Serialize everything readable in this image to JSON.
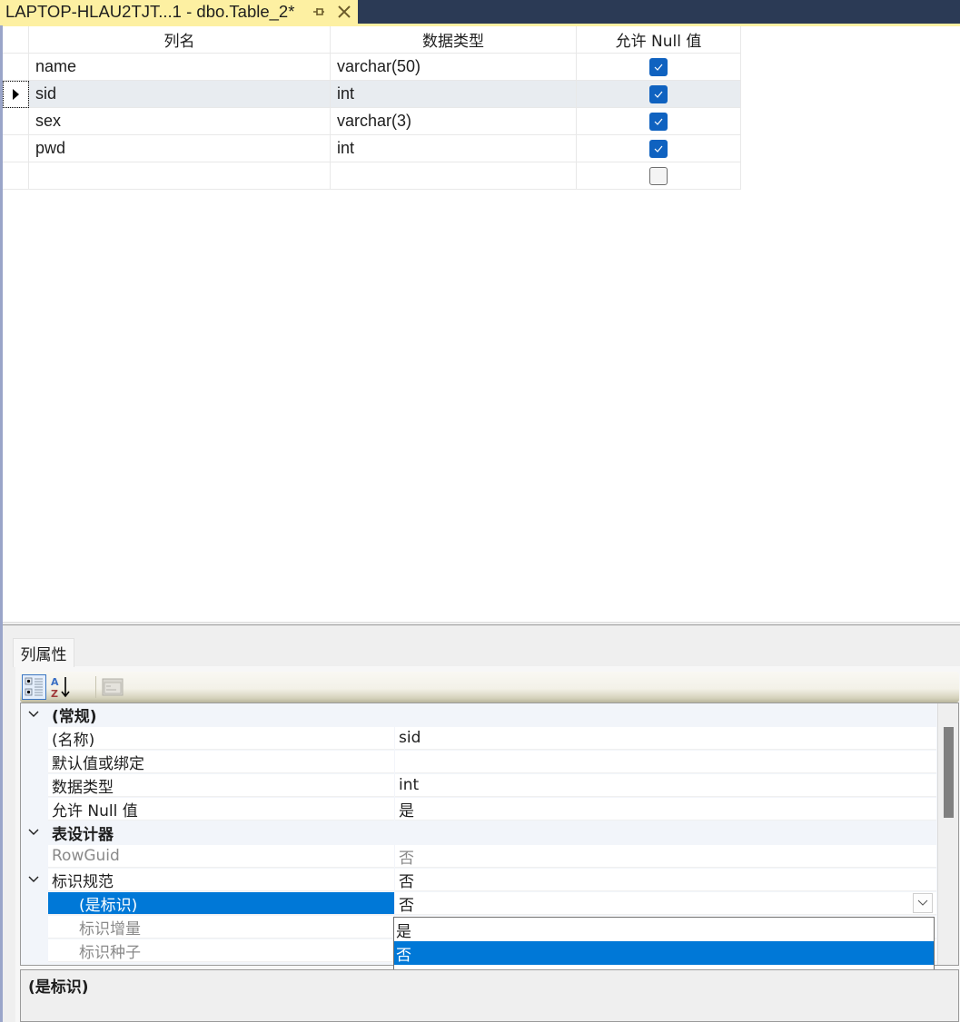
{
  "tab": {
    "title": "LAPTOP-HLAU2TJT...1 - dbo.Table_2*",
    "pin_icon": "pin-icon",
    "close_icon": "close-icon"
  },
  "grid": {
    "headers": {
      "column_name": "列名",
      "data_type": "数据类型",
      "allow_null": "允许 Null 值"
    },
    "rows": [
      {
        "name": "name",
        "type": "varchar(50)",
        "allow_null": true,
        "current": false
      },
      {
        "name": "sid",
        "type": "int",
        "allow_null": true,
        "current": true
      },
      {
        "name": "sex",
        "type": "varchar(3)",
        "allow_null": true,
        "current": false
      },
      {
        "name": "pwd",
        "type": "int",
        "allow_null": true,
        "current": false
      },
      {
        "name": "",
        "type": "",
        "allow_null": false,
        "current": false
      }
    ]
  },
  "properties": {
    "tab_label": "列属性",
    "toolbar": {
      "categorized": "categorized-view-icon",
      "alphabetical": "alphabetical-sort-icon",
      "property_pages": "property-pages-icon"
    },
    "sections": {
      "general": {
        "label": "(常规)"
      },
      "name": {
        "label": "(名称)",
        "value": "sid"
      },
      "default": {
        "label": "默认值或绑定",
        "value": ""
      },
      "datatype": {
        "label": "数据类型",
        "value": "int"
      },
      "allownull": {
        "label": "允许 Null 值",
        "value": "是"
      },
      "designer": {
        "label": "表设计器"
      },
      "rowguid": {
        "label": "RowGuid",
        "value": "否"
      },
      "identity_spec": {
        "label": "标识规范",
        "value": "否"
      },
      "is_identity": {
        "label": "(是标识)",
        "value": "否"
      },
      "identity_increment": {
        "label": "标识增量",
        "value": ""
      },
      "identity_seed": {
        "label": "标识种子",
        "value": ""
      }
    },
    "dropdown_options": [
      "是",
      "否"
    ],
    "dropdown_selected": "否",
    "description": "(是标识)"
  }
}
